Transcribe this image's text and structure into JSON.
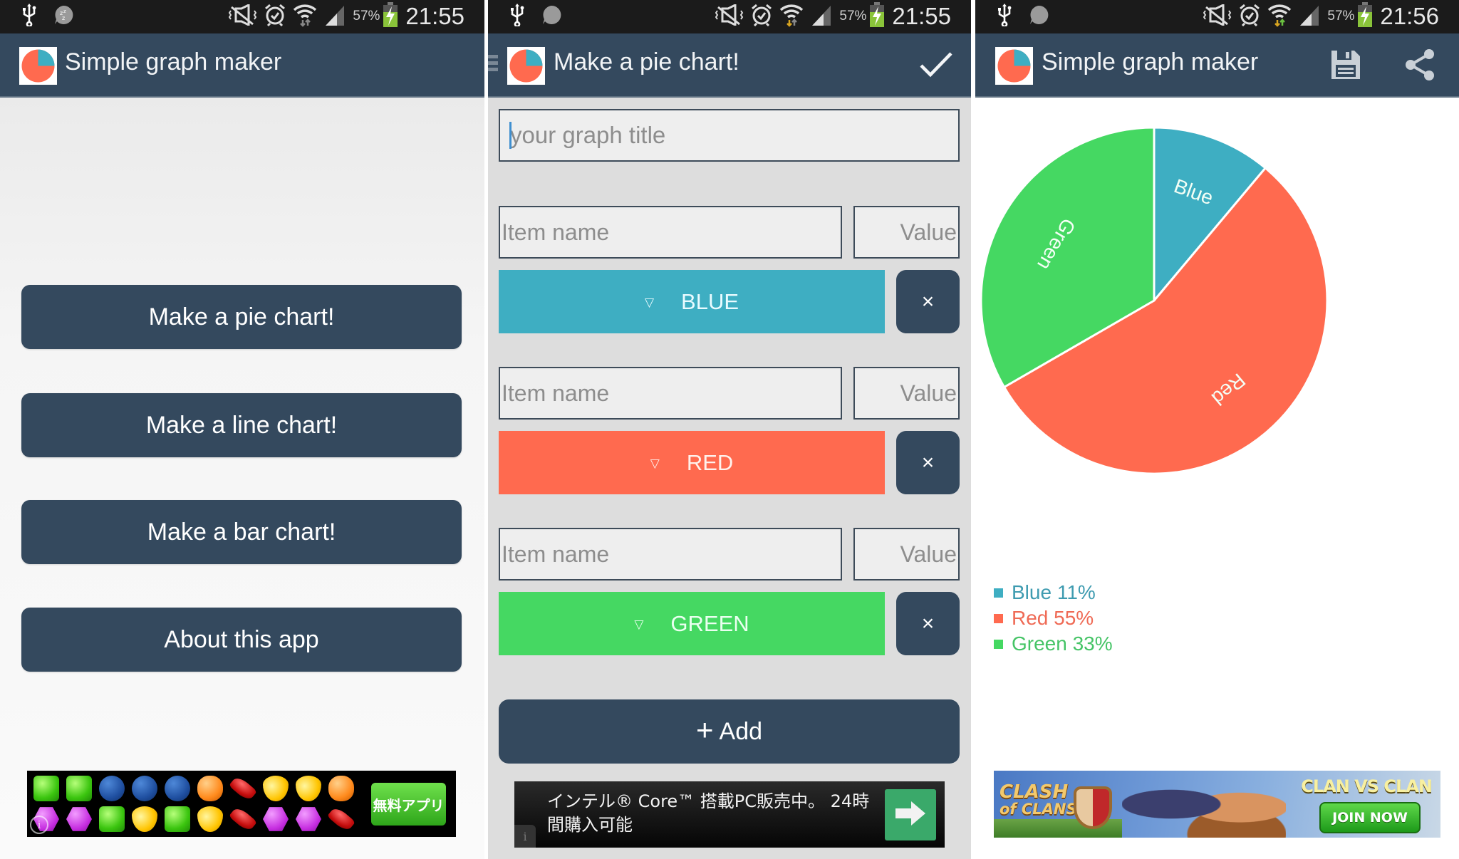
{
  "colors": {
    "appbar": "#34495e",
    "blue": "#3eaec2",
    "red": "#ff6a4f",
    "green": "#45d862",
    "legend_blue_text": "#3e9bb0",
    "legend_red_text": "#ef6a55",
    "legend_green_text": "#45c466"
  },
  "screens": [
    {
      "status_bar": {
        "battery_percent": "57%",
        "time": "21:55",
        "icons": [
          "usb-icon",
          "sleep-notification-icon",
          "mute-vibrate-icon",
          "alarm-icon",
          "wifi-icon",
          "signal-icon",
          "battery-charging-icon"
        ]
      },
      "appbar": {
        "title": "Simple graph maker",
        "logo": "pie-chart-logo"
      },
      "menu": [
        {
          "label": "Make a pie chart!"
        },
        {
          "label": "Make a line chart!"
        },
        {
          "label": "Make a bar chart!"
        },
        {
          "label": "About this app"
        }
      ],
      "ad": {
        "cta_label": "無料アプリ",
        "info": "i"
      }
    },
    {
      "status_bar": {
        "battery_percent": "57%",
        "time": "21:55"
      },
      "appbar": {
        "title": "Make a pie chart!",
        "confirm_icon": "checkmark-icon"
      },
      "form": {
        "title_placeholder": "your graph title",
        "title_value": "",
        "items": [
          {
            "name_placeholder": "Item name",
            "value_placeholder": "Value",
            "name_value": "",
            "value_value": "",
            "color_label": "BLUE",
            "color": "#3eaec2",
            "remove_label": "×"
          },
          {
            "name_placeholder": "Item name",
            "value_placeholder": "Value",
            "name_value": "",
            "value_value": "",
            "color_label": "RED",
            "color": "#ff6a4f",
            "remove_label": "×"
          },
          {
            "name_placeholder": "Item name",
            "value_placeholder": "Value",
            "name_value": "",
            "value_value": "",
            "color_label": "GREEN",
            "color": "#45d862",
            "remove_label": "×"
          }
        ],
        "dropdown_indicator": "▽",
        "add_icon": "+",
        "add_label": "Add"
      },
      "ad": {
        "text": "インテル® Core™ 搭載PC販売中。 24時間購入可能",
        "info": "i"
      }
    },
    {
      "status_bar": {
        "battery_percent": "57%",
        "time": "21:56"
      },
      "appbar": {
        "title": "Simple graph maker",
        "actions": [
          "save-icon",
          "share-icon"
        ]
      },
      "ad": {
        "logo_line1": "CLASH",
        "logo_line2": "of CLANS",
        "headline": "CLAN VS CLAN",
        "cta_label": "JOIN NOW"
      }
    }
  ],
  "chart_data": {
    "type": "pie",
    "title": "",
    "start_angle": "12 o'clock",
    "direction": "clockwise",
    "categories": [
      "Blue",
      "Red",
      "Green"
    ],
    "values": [
      11,
      55,
      33
    ],
    "colors": [
      "#3eaec2",
      "#ff6a4f",
      "#45d862"
    ],
    "legend": [
      {
        "label": "Blue 11%"
      },
      {
        "label": "Red 55%"
      },
      {
        "label": "Green 33%"
      }
    ],
    "legend_position": "bottom-left"
  }
}
